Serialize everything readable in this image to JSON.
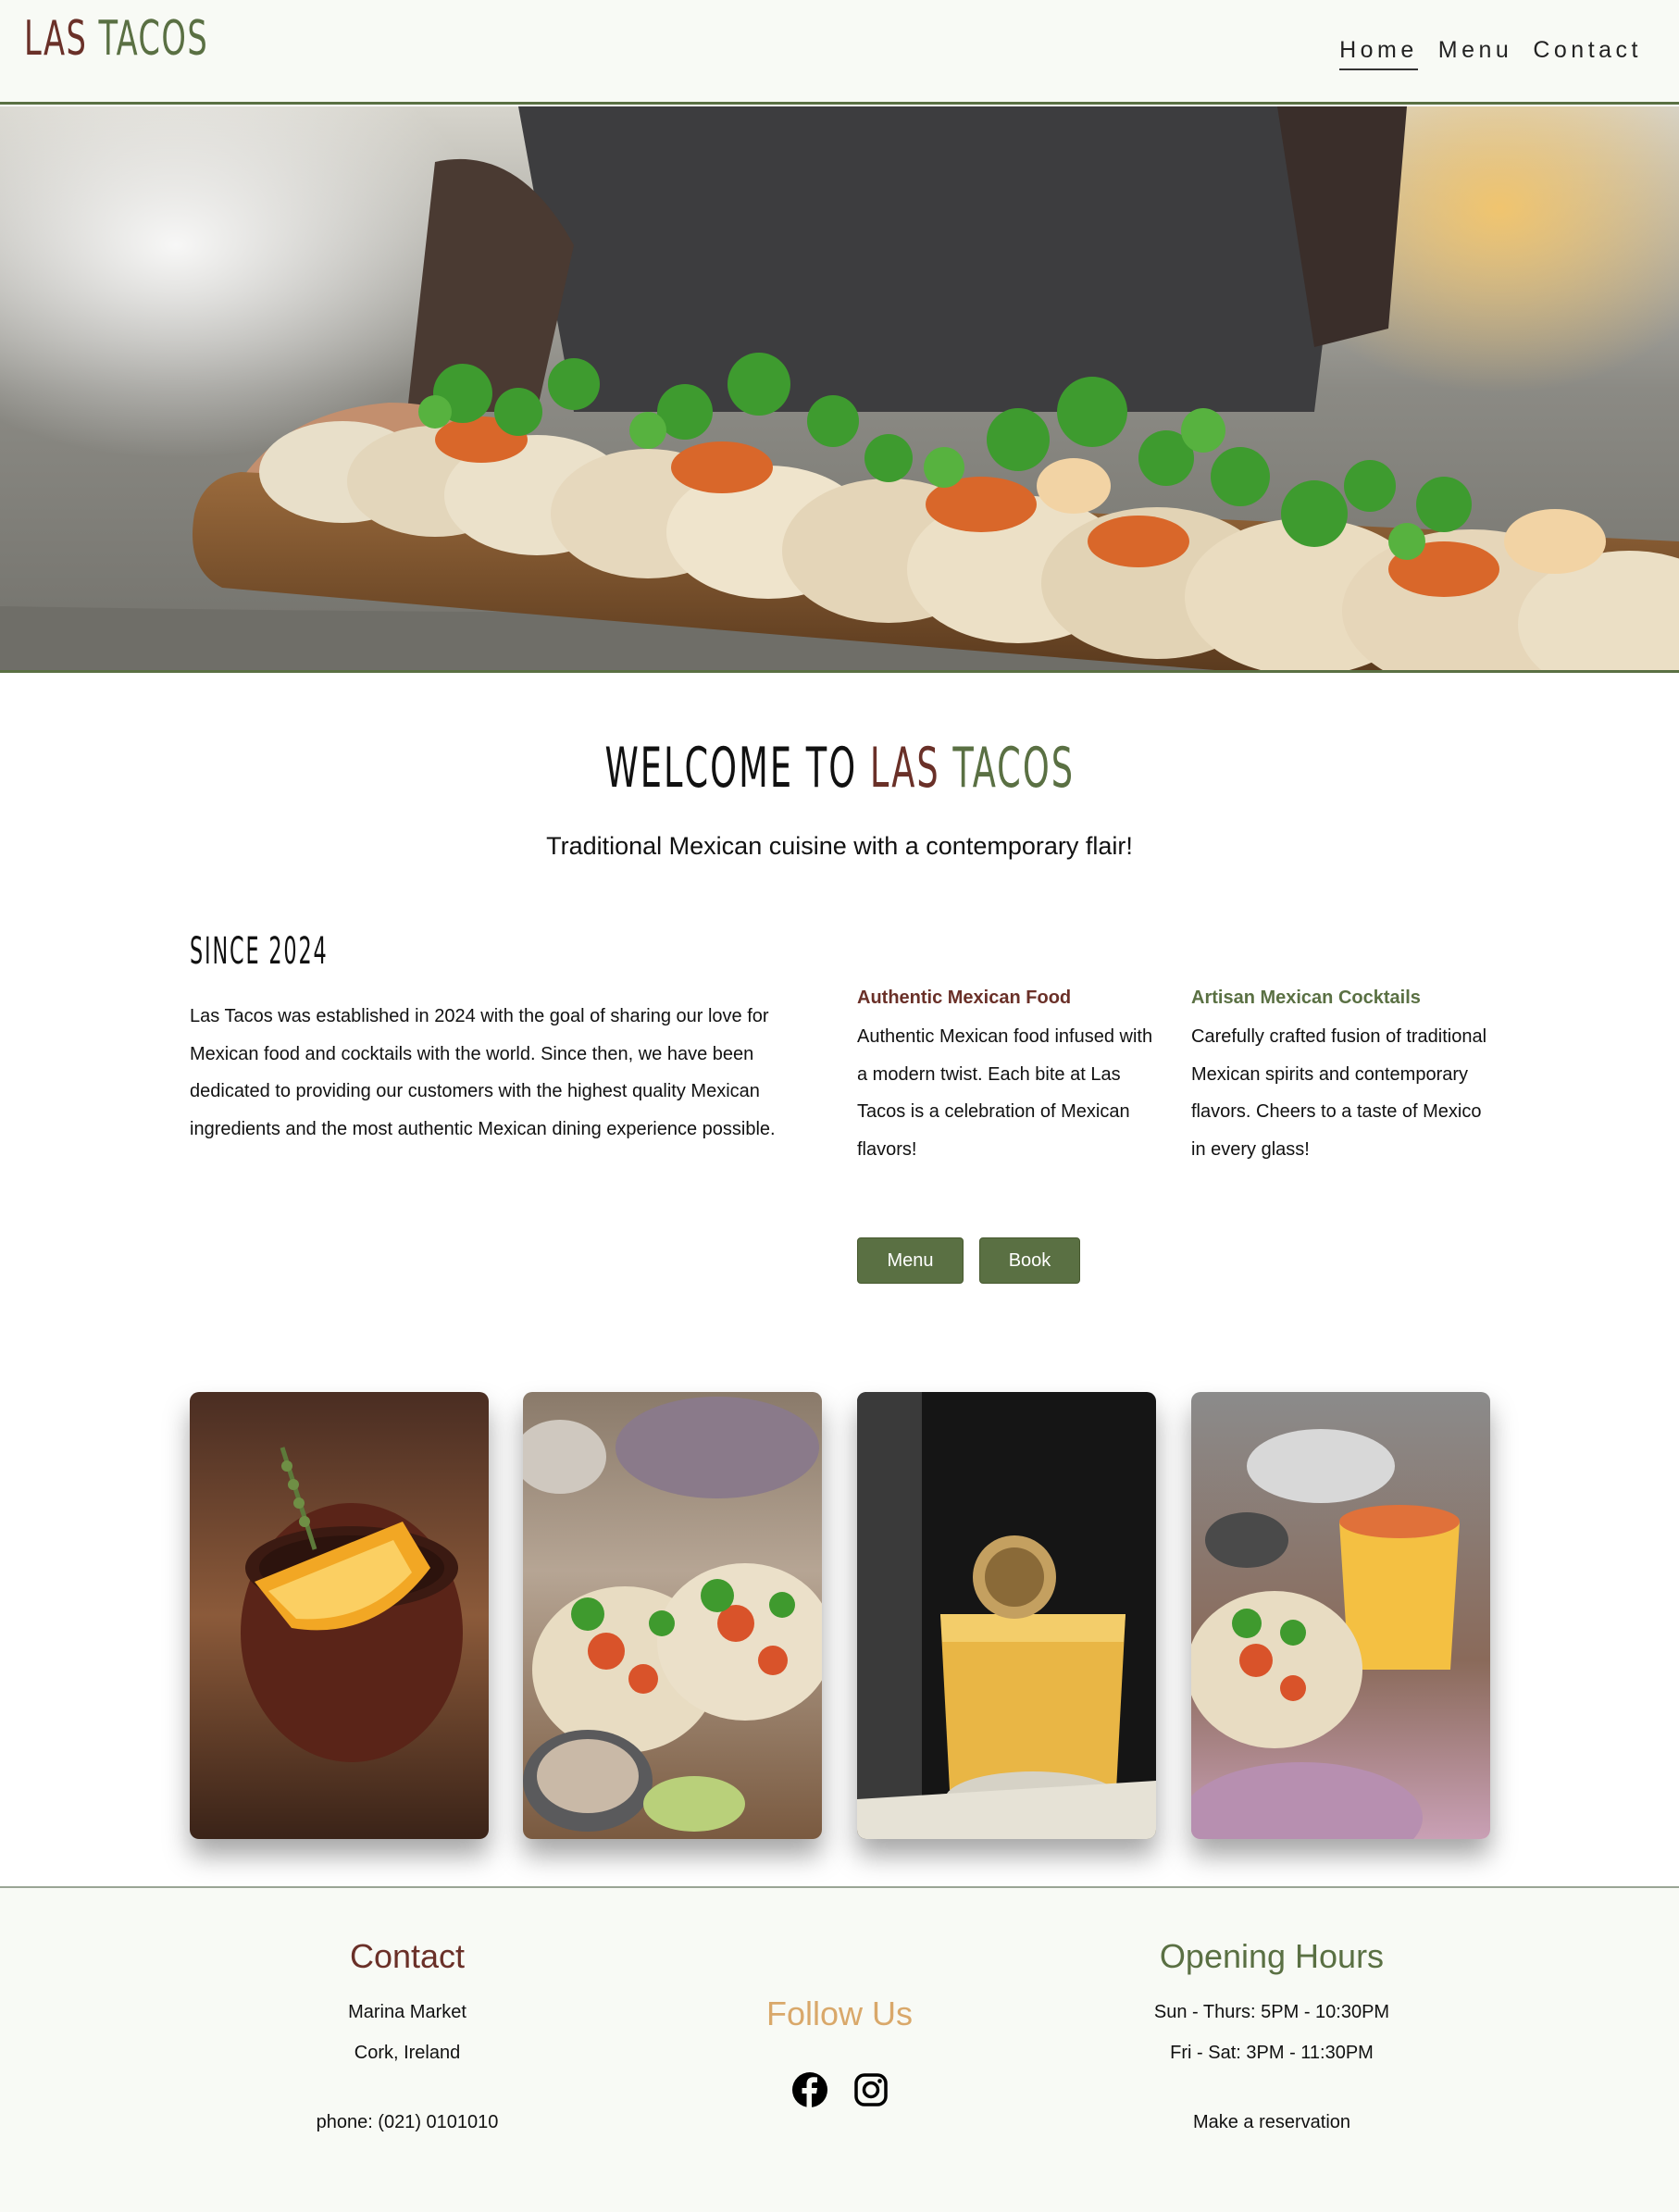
{
  "brand": {
    "word1": "LAS",
    "word2": "TACOS"
  },
  "nav": {
    "items": [
      {
        "label": "Home"
      },
      {
        "label": "Menu"
      },
      {
        "label": "Contact"
      }
    ]
  },
  "hero": {
    "image": "tacos-on-wooden-board-photo"
  },
  "welcome": {
    "title_prefix": "WELCOME TO",
    "title_word1": "LAS",
    "title_word2": "TACOS",
    "tagline": "Traditional Mexican cuisine with a contemporary flair!"
  },
  "about": {
    "heading": "SINCE 2024",
    "text": "Las Tacos was established in 2024 with the goal of sharing our love for Mexican food and cocktails with the world. Since then, we have been dedicated to providing our customers with the highest quality Mexican ingredients and the most authentic Mexican dining experience possible."
  },
  "features": [
    {
      "title": "Authentic Mexican Food",
      "text": "Authentic Mexican food infused with a modern twist. Each bite at Las Tacos is a celebration of Mexican flavors!"
    },
    {
      "title": "Artisan Mexican Cocktails",
      "text": "Carefully crafted fusion of traditional Mexican spirits and contemporary flavors. Cheers to a taste of Mexico in every glass!"
    }
  ],
  "buttons": {
    "menu": "Menu",
    "book": "Book"
  },
  "gallery": [
    {
      "image": "cocktail-with-orange-slice-photo"
    },
    {
      "image": "plated-tacos-photo"
    },
    {
      "image": "yellow-cocktail-photo"
    },
    {
      "image": "tacos-with-juice-photo"
    }
  ],
  "footer": {
    "contact": {
      "heading": "Contact",
      "line1": "Marina Market",
      "line2": "Cork, Ireland",
      "phone": "phone: (021) 0101010"
    },
    "follow": {
      "heading": "Follow Us",
      "icons": [
        "facebook-icon",
        "instagram-icon"
      ]
    },
    "hours": {
      "heading": "Opening Hours",
      "line1": "Sun - Thurs: 5PM - 10:30PM",
      "line2": "Fri - Sat: 3PM - 11:30PM",
      "reservation": "Make a reservation"
    }
  },
  "colors": {
    "brand_red": "#6a3028",
    "brand_green": "#5a7043",
    "follow_gold": "#d9a86a",
    "header_bg": "#f8faf5"
  }
}
